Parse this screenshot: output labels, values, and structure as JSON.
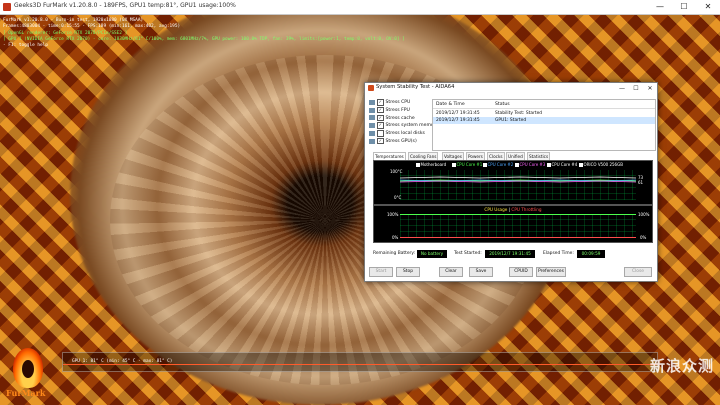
{
  "furmark": {
    "window_title": "Geeks3D FurMark v1.20.8.0 - 189FPS, GPU1 temp:81°, GPU1 usage:100%",
    "win_buttons": [
      "—",
      "☐",
      "✕"
    ],
    "overlay": [
      "FurMark v1.20.8.0 - Burn-in test, 1920x1080 (0X MSAA)",
      "Frames:4803004 - time:0:15:55 - FPS:189 (min:161, max:402, avg:195)",
      "[ OpenGL renderer: GeForce RTX 2070/PCIe/SSE2 ]",
      "[ GPU 1 (NVIDIA GeForce RTX 2070) - core: 1830MHz/81° C/100%, mem: 6801MHz/7%, GPU power: 100.0% TDP, fan: 39%, limits:[power:1, temp:0, volt:0, OV:0] ]",
      "- F1: toggle help"
    ],
    "graph_text": "GPU 1: 81° C (min: 45° C - max: 81° C)",
    "logo_text": "FurMark",
    "watermark": "新浪众测"
  },
  "aida": {
    "window_title": "System Stability Test - AIDA64",
    "win_buttons": [
      "—",
      "☐",
      "✕"
    ],
    "stress_items": [
      {
        "label": "Stress CPU",
        "checked": true
      },
      {
        "label": "Stress FPU",
        "checked": true
      },
      {
        "label": "Stress cache",
        "checked": true
      },
      {
        "label": "Stress system memory",
        "checked": true
      },
      {
        "label": "Stress local disks",
        "checked": false
      },
      {
        "label": "Stress GPU(s)",
        "checked": true
      }
    ],
    "log": {
      "columns": [
        "Date & Time",
        "Status"
      ],
      "rows": [
        [
          "2019/12/7 19:31:45",
          "Stability Test: Started"
        ],
        [
          "2019/12/7 19:31:45",
          "GPU1: Started"
        ]
      ]
    },
    "tabs": [
      "Temperatures",
      "Cooling Fans",
      "Voltages",
      "Powers",
      "Clocks",
      "Unified",
      "Statistics"
    ],
    "active_tab": 0,
    "temp_legend": [
      {
        "label": "Motherboard",
        "color": "#ffffff"
      },
      {
        "label": "CPU Core #1",
        "color": "#4dff4d"
      },
      {
        "label": "CPU Core #2",
        "color": "#4da6ff"
      },
      {
        "label": "CPU Core #3",
        "color": "#ff66ff"
      },
      {
        "label": "CPU Core #4",
        "color": "#ffffff"
      },
      {
        "label": "ORICO V500 256GB",
        "color": "#ffffff"
      }
    ],
    "temp_axis": {
      "top": "100°C",
      "bottom": "0°C",
      "right_top": "73",
      "right_mid": "61"
    },
    "cpu_title_a": "CPU Usage",
    "cpu_title_sep": " | ",
    "cpu_title_b": "CPU Throttling",
    "cpu_axis": {
      "top_left": "100%",
      "bottom_left": "0%",
      "top_right": "100%",
      "bottom_right": "0%"
    },
    "status": {
      "battery_label": "Remaining Battery:",
      "battery_value": "No battery",
      "started_label": "Test Started:",
      "started_value": "2019/12/7 19:31:45",
      "elapsed_label": "Elapsed Time:",
      "elapsed_value": "00:09:59"
    },
    "buttons": {
      "start": "Start",
      "stop": "Stop",
      "clear": "Clear",
      "save": "Save",
      "cpuid": "CPUID",
      "preferences": "Preferences",
      "close": "Close"
    },
    "colors": {
      "graph_green": "#00a03c",
      "text_green": "#7dff6a",
      "accent_orange": "#ff8a1a"
    }
  }
}
